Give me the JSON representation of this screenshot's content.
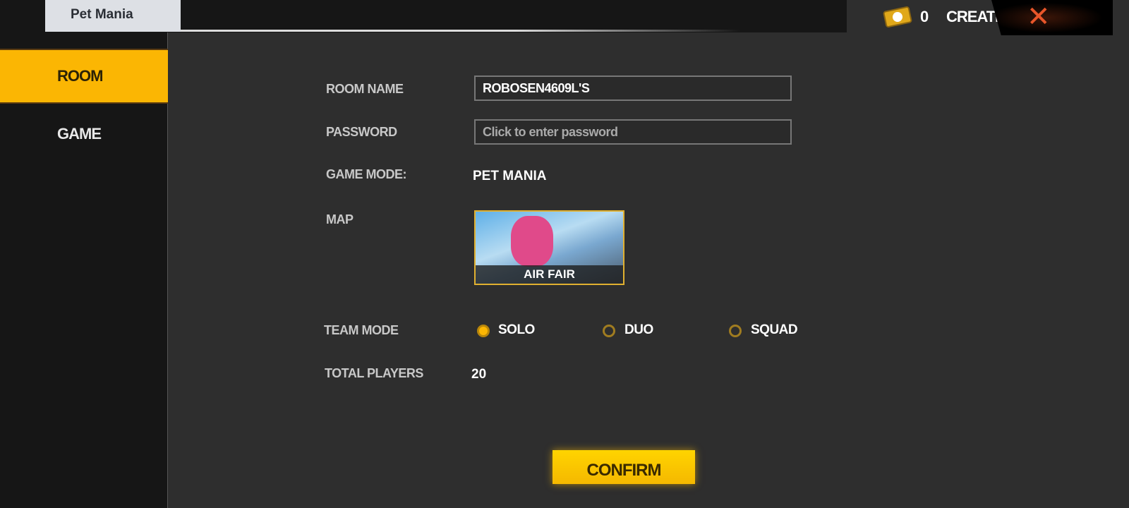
{
  "header": {
    "tab_title": "Pet Mania",
    "ticket_count": "0",
    "create_label": "CREATE",
    "close_icon": "close-icon",
    "accent": "#fbb603",
    "close_color": "#e8562a"
  },
  "sidebar": {
    "items": [
      {
        "label": "ROOM",
        "active": true
      },
      {
        "label": "GAME",
        "active": false
      }
    ]
  },
  "form": {
    "room_name_label": "ROOM NAME",
    "room_name_value": "ROBOSEN4609L'S",
    "password_label": "PASSWORD",
    "password_placeholder": "Click to enter password",
    "game_mode_label": "GAME MODE:",
    "game_mode_value": "PET MANIA",
    "map_label": "MAP",
    "map_name": "AIR FAIR",
    "team_mode_label": "TEAM MODE",
    "team_modes": [
      {
        "label": "SOLO",
        "selected": true
      },
      {
        "label": "DUO",
        "selected": false
      },
      {
        "label": "SQUAD",
        "selected": false
      }
    ],
    "total_players_label": "TOTAL PLAYERS",
    "total_players_value": "20",
    "confirm_label": "CONFIRM"
  }
}
